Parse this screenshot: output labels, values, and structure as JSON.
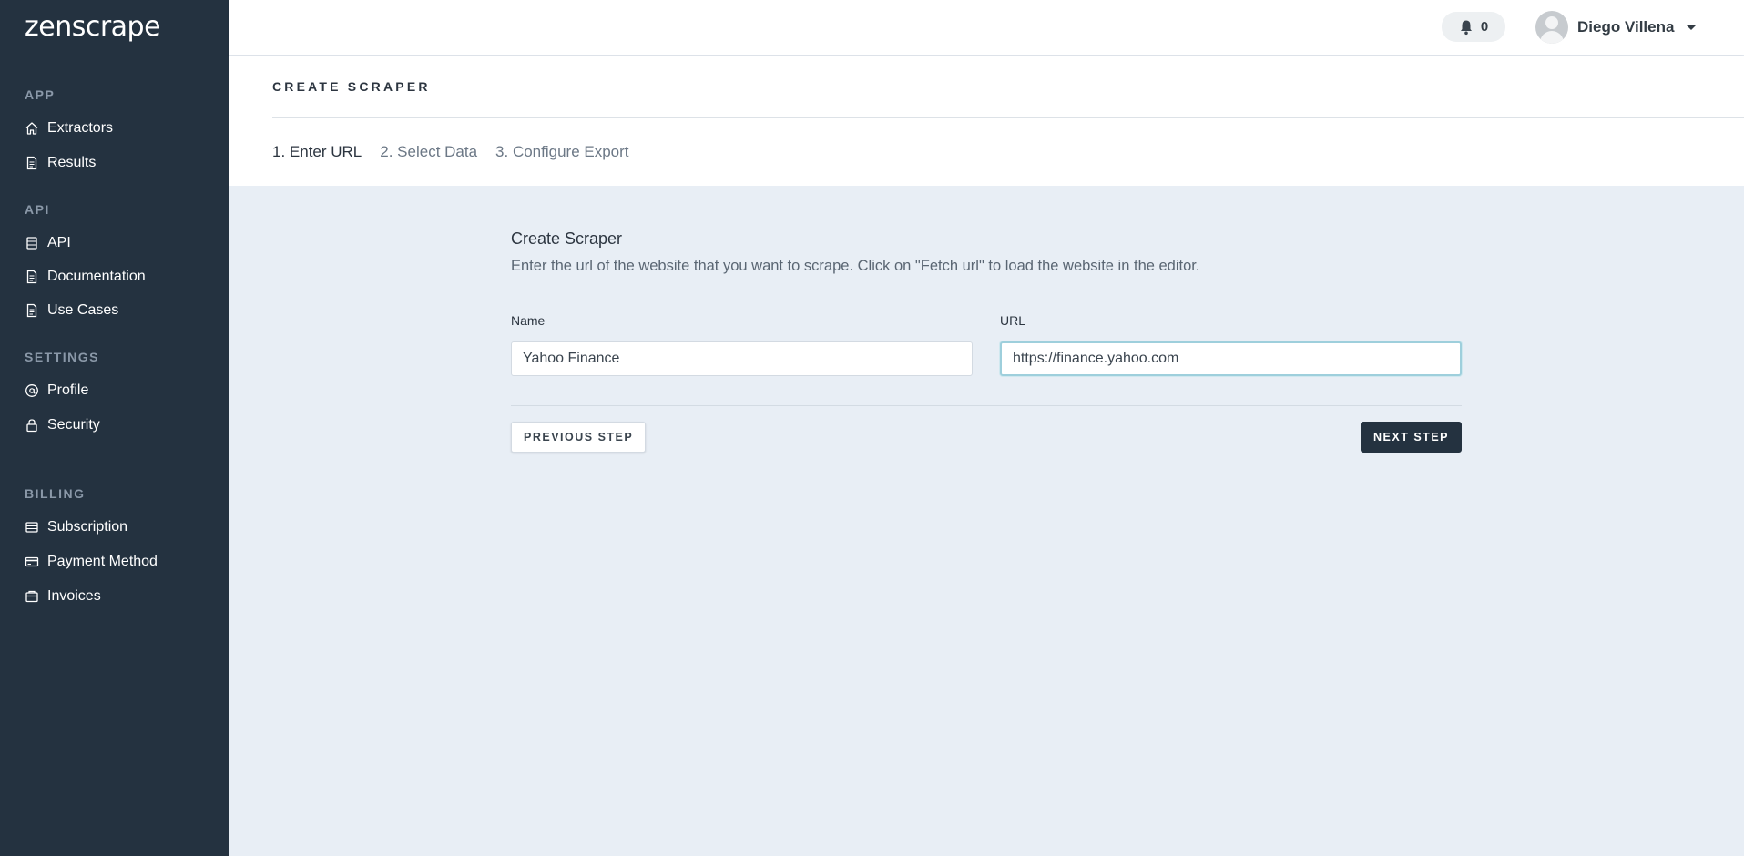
{
  "app": {
    "logo": "zenscrape"
  },
  "sidebar": {
    "sections": [
      {
        "title": "APP",
        "items": [
          {
            "label": "Extractors",
            "icon": "home-icon"
          },
          {
            "label": "Results",
            "icon": "document-icon"
          }
        ]
      },
      {
        "title": "API",
        "items": [
          {
            "label": "API",
            "icon": "stack-icon"
          },
          {
            "label": "Documentation",
            "icon": "document-icon"
          },
          {
            "label": "Use Cases",
            "icon": "document-icon"
          }
        ]
      },
      {
        "title": "SETTINGS",
        "items": [
          {
            "label": "Profile",
            "icon": "at-icon"
          },
          {
            "label": "Security",
            "icon": "lock-icon"
          }
        ]
      },
      {
        "title": "BILLING",
        "items": [
          {
            "label": "Subscription",
            "icon": "stack-icon"
          },
          {
            "label": "Payment Method",
            "icon": "credit-card-icon"
          },
          {
            "label": "Invoices",
            "icon": "invoice-icon"
          }
        ]
      }
    ]
  },
  "topbar": {
    "notifications_count": "0",
    "user_name": "Diego Villena"
  },
  "header": {
    "title": "CREATE SCRAPER",
    "steps": [
      "1. Enter URL",
      "2. Select Data",
      "3. Configure Export"
    ],
    "active_step": 0
  },
  "form": {
    "title": "Create Scraper",
    "description": "Enter the url of the website that you want to scrape. Click on \"Fetch url\" to load the website in the editor.",
    "name_label": "Name",
    "name_value": "Yahoo Finance",
    "url_label": "URL",
    "url_value": "https://finance.yahoo.com",
    "prev_button": "PREVIOUS STEP",
    "next_button": "NEXT STEP"
  },
  "colors": {
    "sidebar_bg": "#243240",
    "content_bg": "#e8eef5",
    "focus_ring": "#9ecfdc"
  }
}
